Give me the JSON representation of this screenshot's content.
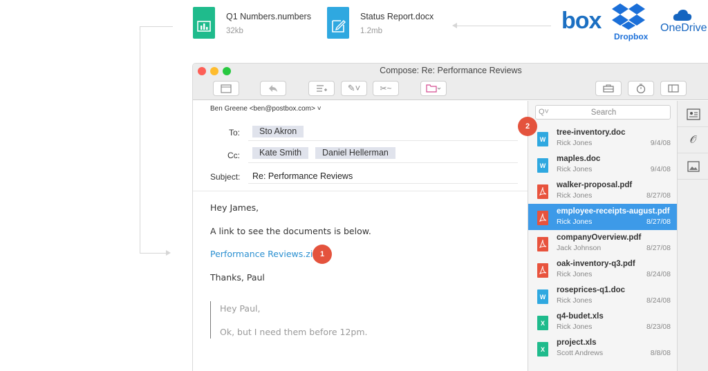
{
  "top_files": [
    {
      "name": "Q1 Numbers.numbers",
      "size": "32kb",
      "icon": "numbers-file-icon",
      "color": "#1fbb8c"
    },
    {
      "name": "Status Report.docx",
      "size": "1.2mb",
      "icon": "word-file-icon",
      "color": "#2fa8e0"
    }
  ],
  "services": {
    "box": "box",
    "dropbox": "Dropbox",
    "onedrive": "OneDrive"
  },
  "window": {
    "title": "Compose: Re: Performance Reviews"
  },
  "toolbar": {
    "icons": [
      "calendar-icon",
      "reply-icon",
      "insert-list-icon",
      "attach-icon",
      "signature-icon",
      "folder-icon",
      "briefcase-icon",
      "timer-icon",
      "sidebar-toggle-icon"
    ]
  },
  "compose": {
    "from": "Ben Greene <ben@postbox.com> ˅",
    "to_label": "To:",
    "to": [
      "Sto Akron"
    ],
    "cc_label": "Cc:",
    "cc": [
      "Kate Smith",
      "Daniel Hellerman"
    ],
    "subject_label": "Subject:",
    "subject": "Re: Performance Reviews"
  },
  "body": {
    "greeting": "Hey James,",
    "line1": "A link to see the documents is below.",
    "link": "Performance Reviews.zip",
    "signoff": "Thanks, Paul",
    "quote_greeting": "Hey Paul,",
    "quote_line": "Ok, but I need them before 12pm."
  },
  "badges": {
    "one": "1",
    "two": "2"
  },
  "search": {
    "placeholder": "Search"
  },
  "files": [
    {
      "name": "tree-inventory.doc",
      "author": "Rick Jones",
      "date": "9/4/08",
      "type": "W",
      "color": "#2fa8e0",
      "selected": false
    },
    {
      "name": "maples.doc",
      "author": "Rick Jones",
      "date": "9/4/08",
      "type": "W",
      "color": "#2fa8e0",
      "selected": false
    },
    {
      "name": "walker-proposal.pdf",
      "author": "Rick Jones",
      "date": "8/27/08",
      "type": "pdf",
      "color": "#e8533d",
      "selected": false
    },
    {
      "name": "employee-receipts-august.pdf",
      "author": "Rick Jones",
      "date": "8/27/08",
      "type": "pdf",
      "color": "#e8533d",
      "selected": true
    },
    {
      "name": "companyOverview.pdf",
      "author": "Jack Johnson",
      "date": "8/27/08",
      "type": "pdf",
      "color": "#e8533d",
      "selected": false
    },
    {
      "name": "oak-inventory-q3.pdf",
      "author": "Rick Jones",
      "date": "8/24/08",
      "type": "pdf",
      "color": "#e8533d",
      "selected": false
    },
    {
      "name": "roseprices-q1.doc",
      "author": "Rick Jones",
      "date": "8/24/08",
      "type": "W",
      "color": "#2fa8e0",
      "selected": false
    },
    {
      "name": "q4-budet.xls",
      "author": "Rick Jones",
      "date": "8/23/08",
      "type": "X",
      "color": "#1fbb8c",
      "selected": false
    },
    {
      "name": "project.xls",
      "author": "Scott Andrews",
      "date": "8/8/08",
      "type": "X",
      "color": "#1fbb8c",
      "selected": false
    }
  ],
  "side_tabs": [
    "contacts-icon",
    "attachment-icon",
    "image-icon"
  ],
  "colors": {
    "accent": "#3d9ae8",
    "badge": "#e4533d",
    "link": "#2a8fd0"
  }
}
